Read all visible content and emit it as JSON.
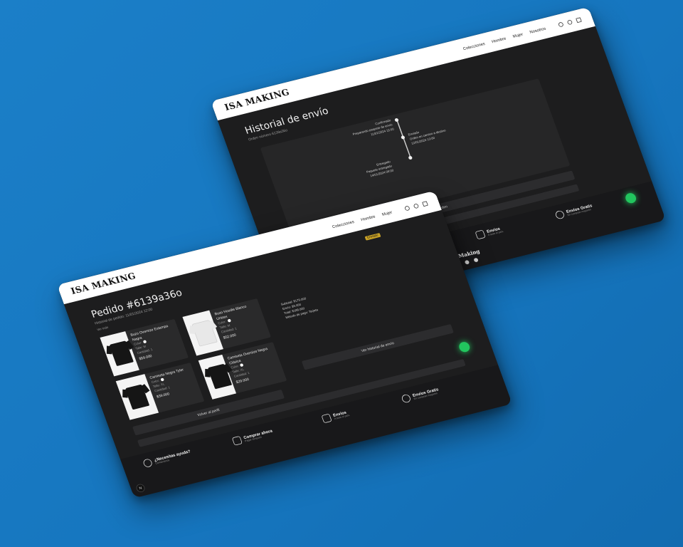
{
  "site": {
    "logo": "ISA MAKING",
    "nav": [
      "Colecciones",
      "Hombre",
      "Mujer",
      "Nosotros"
    ]
  },
  "back_screen": {
    "title": "Historial de envío",
    "subtitle": "Orden número 6139a36o",
    "timeline": [
      {
        "status": "Confirmado",
        "detail": "Preparando paquete de envío",
        "date": "11/01/2024 12:00"
      },
      {
        "status": "Enviado",
        "detail": "Orden en camino a destino",
        "date": "12/01/2024 13:00"
      },
      {
        "status": "Entregado",
        "detail": "Paquete entregado",
        "date": "14/01/2024 09:00"
      }
    ],
    "back_button": "Volver a la orden"
  },
  "front_screen": {
    "title": "Pedido #6139a36o",
    "subtitle": "Historial de pedido: 11/01/2024 12:00",
    "filter_label": "Ver todo",
    "badge": "Enviado",
    "products": [
      {
        "name": "Buzo Oversize Estampa Negra",
        "color_label": "Color:",
        "size": "Talle: M",
        "qty": "Cantidad: 1",
        "price": "$59.000"
      },
      {
        "name": "Buzo Hoodie Blanco Unisex",
        "color_label": "Color:",
        "size": "Talle: M",
        "qty": "Cantidad: 1",
        "price": "$52.000"
      },
      {
        "name": "Camiseta Negra Tyler",
        "color_label": "Color:",
        "size": "Talle: XL",
        "qty": "Cantidad: 1",
        "price": "$39.000"
      },
      {
        "name": "Camiseta Oversize Negra Clásica",
        "color_label": "Color:",
        "size": "Talle: XL",
        "qty": "Cantidad: 1",
        "price": "$29.000"
      }
    ],
    "summary_lines": [
      "Subtotal: $179.000",
      "Envío: $9.000",
      "Total: $188.000",
      "Método de pago: Tarjeta"
    ],
    "back_link": "Volver al perfil",
    "history_button": "Ver historial de envío"
  },
  "footer": {
    "features": [
      {
        "title": "¿Necesitas ayuda?",
        "sub": "Contáctanos",
        "icon": "whatsapp-icon"
      },
      {
        "title": "Comprar ahora",
        "sub": "Pagar después",
        "icon": "box-icon"
      },
      {
        "title": "Envíos",
        "sub": "A todo el país",
        "icon": "truck-icon"
      },
      {
        "title": "Envíos Gratis",
        "sub": "En compras mayores",
        "icon": "dollar-icon"
      }
    ],
    "brand": "ISA Making"
  },
  "colors": {
    "accent_green": "#22c55e",
    "bg_blue": "#1676bf",
    "panel_dark": "#1d1d1e"
  }
}
